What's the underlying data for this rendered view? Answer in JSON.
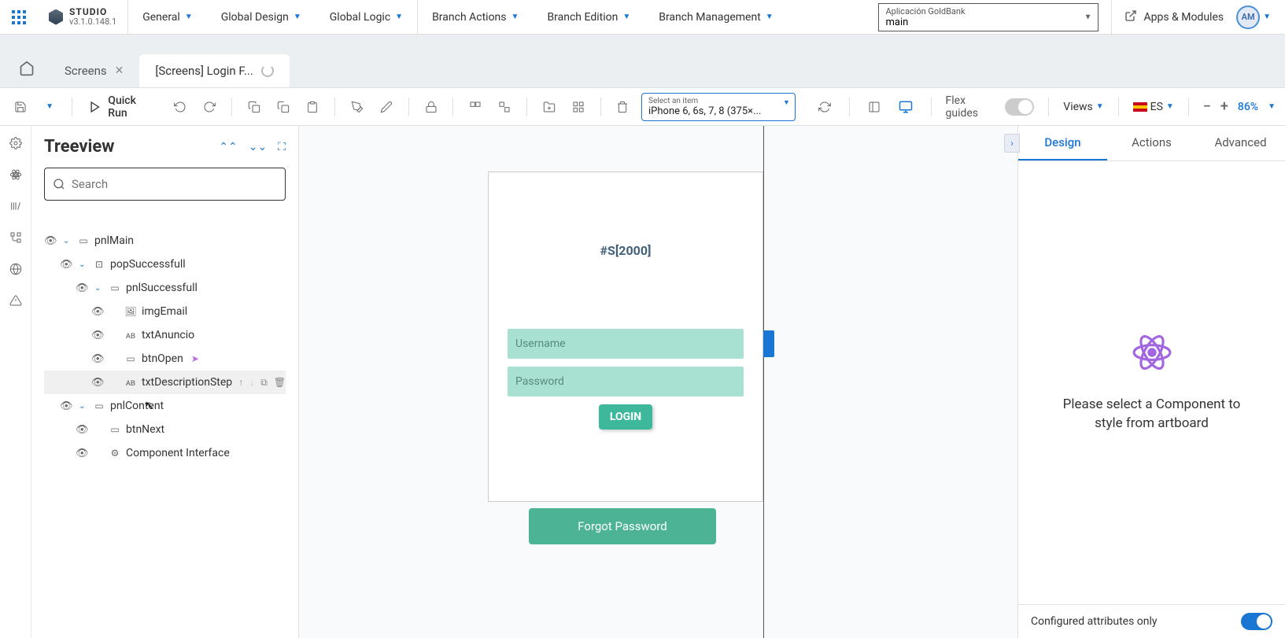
{
  "app": {
    "name": "STUDIO",
    "version": "v3.1.0.148.1"
  },
  "mainMenu": {
    "general": "General",
    "globalDesign": "Global Design",
    "globalLogic": "Global Logic",
    "branchActions": "Branch Actions",
    "branchEdition": "Branch Edition",
    "branchManagement": "Branch Management"
  },
  "appSelector": {
    "label": "Aplicación GoldBank",
    "value": "main"
  },
  "topRight": {
    "appsModules": "Apps & Modules",
    "avatar": "AM"
  },
  "tabs": {
    "t1": "Screens",
    "t2": "[Screens] Login F..."
  },
  "toolbar": {
    "quickRun": "Quick Run",
    "deviceLabel": "Select an item",
    "deviceValue": "iPhone 6, 6s, 7, 8 (375×...",
    "flexGuides": "Flex guides",
    "views": "Views",
    "lang": "ES",
    "zoom": "86%"
  },
  "treeview": {
    "title": "Treeview",
    "searchPlaceholder": "Search",
    "nodes": {
      "pnlMain": "pnlMain",
      "popSuccessfull": "popSuccessfull",
      "pnlSuccessfull": "pnlSuccessfull",
      "imgEmail": "imgEmail",
      "txtAnuncio": "txtAnuncio",
      "btnOpen": "btnOpen",
      "txtDescriptionStep": "txtDescriptionStep",
      "pnlContent": "pnlContent",
      "btnNext": "btnNext",
      "componentInterface": "Component Interface"
    }
  },
  "artboard": {
    "heading": "#S[2000]",
    "username": "Username",
    "password": "Password",
    "login": "LOGIN",
    "forgot": "Forgot Password"
  },
  "rightPanel": {
    "tabDesign": "Design",
    "tabActions": "Actions",
    "tabAdvanced": "Advanced",
    "message": "Please select a Component to style from artboard",
    "footer": "Configured attributes only"
  }
}
